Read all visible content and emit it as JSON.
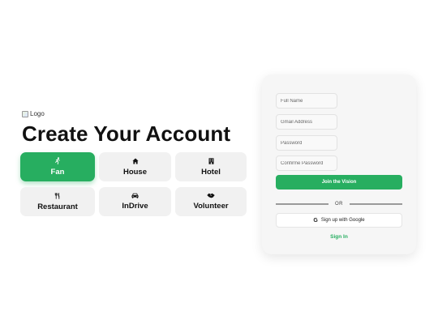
{
  "logo": {
    "alt_text": "Logo"
  },
  "page_title": "Create Your Account",
  "roles": [
    {
      "label": "Fan",
      "icon": "running-person-icon",
      "glyph": "🏃︎",
      "active": true
    },
    {
      "label": "House",
      "icon": "house-icon",
      "glyph": "⌂",
      "active": false
    },
    {
      "label": "Hotel",
      "icon": "building-icon",
      "glyph": "▦",
      "active": false
    },
    {
      "label": "Restaurant",
      "icon": "utensils-icon",
      "glyph": "¶¶",
      "active": false
    },
    {
      "label": "InDrive",
      "icon": "car-icon",
      "glyph": "▬",
      "active": false
    },
    {
      "label": "Volunteer",
      "icon": "handshake-icon",
      "glyph": "◆",
      "active": false
    }
  ],
  "form": {
    "full_name_placeholder": "Full Name",
    "email_placeholder": "Gmail Address",
    "password_placeholder": "Password",
    "confirm_password_placeholder": "Confirme Password",
    "submit_label": "Join the Vision",
    "divider_text": "OR",
    "google_label": "Sign up with Google",
    "google_icon": "google-icon",
    "signin_label": "Sign In"
  },
  "colors": {
    "accent": "#27ae60",
    "tile_background": "#f1f1f1",
    "panel_background": "#f6f6f6"
  }
}
